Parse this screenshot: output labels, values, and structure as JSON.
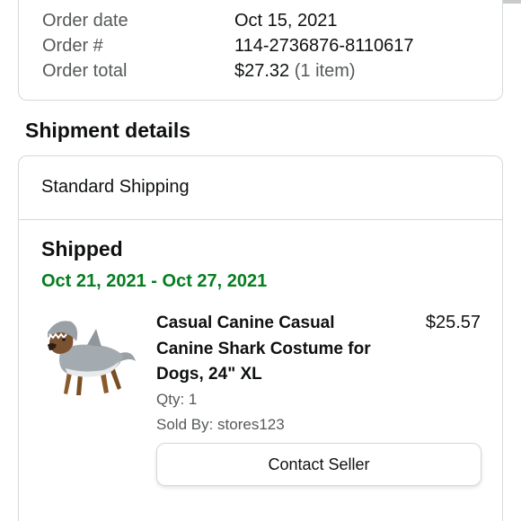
{
  "order_summary": {
    "rows": [
      {
        "label": "Order date",
        "value": "Oct 15, 2021"
      },
      {
        "label": "Order #",
        "value": "114-2736876-8110617"
      },
      {
        "label": "Order total",
        "value": "$27.32",
        "value_note": "(1 item)"
      }
    ]
  },
  "shipment": {
    "section_title": "Shipment details",
    "method": "Standard Shipping",
    "status": "Shipped",
    "delivery_range": "Oct 21, 2021 - Oct 27, 2021",
    "item": {
      "image_icon": "dog-shark-costume-photo",
      "title": "Casual Canine Casual Canine Shark Costume for Dogs, 24\" XL",
      "price": "$25.57",
      "qty": "Qty: 1",
      "sold_by": "Sold By: stores123"
    },
    "contact_button": "Contact Seller"
  },
  "colors": {
    "delivery_green": "#067d1f",
    "border": "#d5d9d9",
    "muted_text": "#565959"
  }
}
